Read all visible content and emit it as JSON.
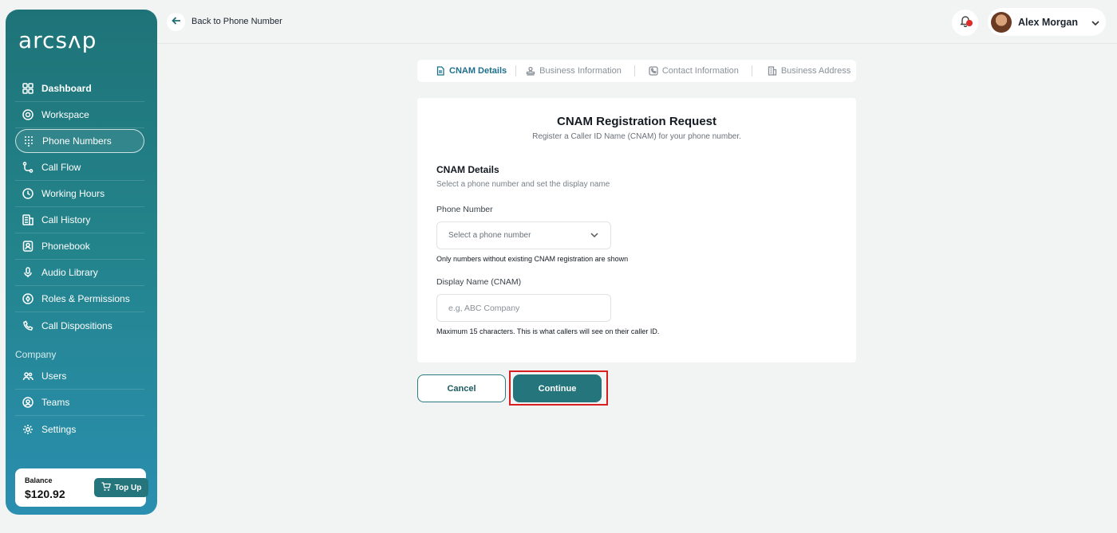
{
  "brand": {
    "logo_text": "arcsʌp"
  },
  "sidebar": {
    "items": [
      {
        "label": "Dashboard",
        "icon": "grid-icon"
      },
      {
        "label": "Workspace",
        "icon": "lifebuoy-icon"
      },
      {
        "label": "Phone Numbers",
        "icon": "keypad-icon"
      },
      {
        "label": "Call Flow",
        "icon": "flow-icon"
      },
      {
        "label": "Working Hours",
        "icon": "clock-icon"
      },
      {
        "label": "Call History",
        "icon": "history-icon"
      },
      {
        "label": "Phonebook",
        "icon": "contact-book-icon"
      },
      {
        "label": "Audio Library",
        "icon": "microphone-icon"
      },
      {
        "label": "Roles & Permissions",
        "icon": "shield-icon"
      },
      {
        "label": "Call Dispositions",
        "icon": "phone-icon"
      }
    ],
    "company_title": "Company",
    "company_items": [
      {
        "label": "Users",
        "icon": "users-icon"
      },
      {
        "label": "Teams",
        "icon": "team-icon"
      },
      {
        "label": "Settings",
        "icon": "gear-icon"
      }
    ],
    "balance": {
      "label": "Balance",
      "value": "$120.92",
      "topup_label": "Top Up"
    }
  },
  "header": {
    "back_label": "Back to Phone Number",
    "user_name": "Alex Morgan"
  },
  "steps": [
    {
      "label": "CNAM Details",
      "active": true
    },
    {
      "label": "Business Information",
      "active": false
    },
    {
      "label": "Contact Information",
      "active": false
    },
    {
      "label": "Business Address",
      "active": false
    }
  ],
  "form": {
    "title": "CNAM Registration Request",
    "subtitle": "Register a Caller ID Name (CNAM) for your phone number.",
    "section_title": "CNAM Details",
    "section_subtitle": "Select a phone number and set the display name",
    "phone_label": "Phone Number",
    "phone_placeholder": "Select a phone number",
    "phone_hint": "Only numbers without existing CNAM registration are shown",
    "display_label": "Display Name (CNAM)",
    "display_placeholder": "e.g, ABC Company",
    "display_hint": "Maximum 15 characters. This is what callers will see on their caller ID."
  },
  "actions": {
    "cancel_label": "Cancel",
    "continue_label": "Continue"
  },
  "colors": {
    "accent": "#24767c",
    "active_step": "#1d6f8c",
    "highlight": "#d81e1e"
  }
}
